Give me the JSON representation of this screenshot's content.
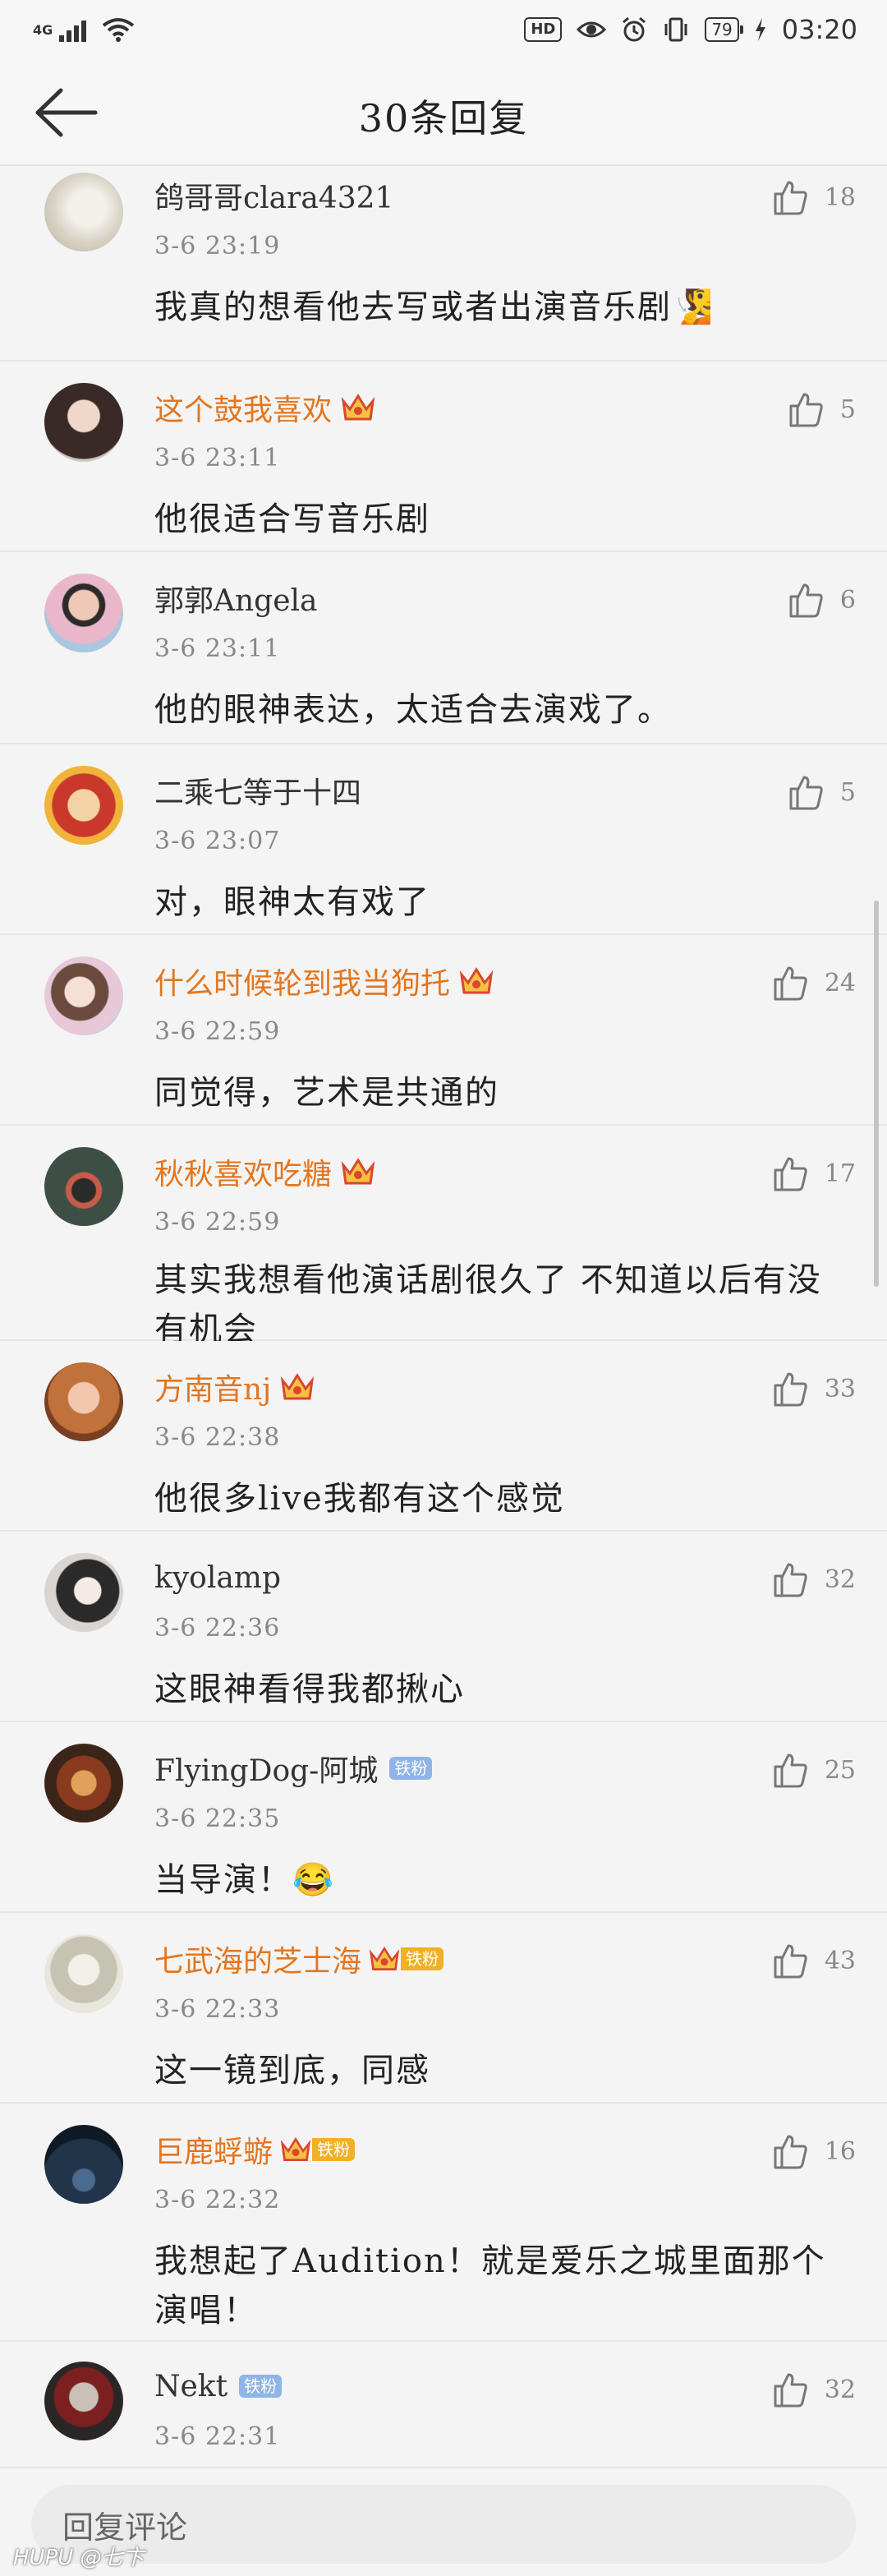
{
  "status_bar": {
    "network": "4G",
    "hd": "HD",
    "battery": "79",
    "time": "03:20"
  },
  "header": {
    "title": "30条回复"
  },
  "comments": [
    {
      "name": "鸽哥哥clara4321",
      "vip": false,
      "time": "3-6  23:19",
      "content": "我真的想看他去写或者出演音乐剧🧏",
      "likes": "18"
    },
    {
      "name": "这个鼓我喜欢",
      "vip": true,
      "time": "3-6  23:11",
      "content": "他很适合写音乐剧",
      "likes": "5"
    },
    {
      "name": "郭郭Angela",
      "vip": false,
      "time": "3-6  23:11",
      "content": "他的眼神表达，太适合去演戏了。",
      "likes": "6"
    },
    {
      "name": "二乘七等于十四",
      "vip": false,
      "time": "3-6  23:07",
      "content": "对，眼神太有戏了",
      "likes": "5"
    },
    {
      "name": "什么时候轮到我当狗托",
      "vip": true,
      "time": "3-6  22:59",
      "content": "同觉得，艺术是共通的",
      "likes": "24"
    },
    {
      "name": "秋秋喜欢吃糖",
      "vip": true,
      "time": "3-6  22:59",
      "content": "其实我想看他演话剧很久了 不知道以后有没有机会",
      "likes": "17"
    },
    {
      "name": "方南音nj",
      "vip": true,
      "time": "3-6  22:38",
      "content": "他很多live我都有这个感觉",
      "likes": "33"
    },
    {
      "name": "kyolamp",
      "vip": false,
      "time": "3-6  22:36",
      "content": "这眼神看得我都揪心",
      "likes": "32"
    },
    {
      "name": "FlyingDog-阿城",
      "vip": false,
      "fan_tag": "铁粉",
      "time": "3-6  22:35",
      "content": "当导演！😂",
      "likes": "25"
    },
    {
      "name": "七武海的芝士海",
      "vip": true,
      "fan_tag": "铁粉",
      "time": "3-6  22:33",
      "content": "这一镜到底，同感",
      "likes": "43"
    },
    {
      "name": "巨鹿蜉蝣",
      "vip": true,
      "fan_tag": "铁粉",
      "time": "3-6  22:32",
      "content": "我想起了Audition！就是爱乐之城里面那个演唱！",
      "likes": "16"
    },
    {
      "name": "Nekt",
      "vip": false,
      "fan_tag": "铁粉",
      "time": "3-6  22:31",
      "content": "",
      "likes": "32"
    }
  ],
  "reply_bar": {
    "placeholder": "回复评论"
  },
  "watermark": "HUPU @七卞",
  "colors": {
    "vip_name": "#e2761f",
    "fan_tag": "#8fb4e8",
    "vip_fan_tag": "#f0b128",
    "background": "#f4f4f4"
  }
}
